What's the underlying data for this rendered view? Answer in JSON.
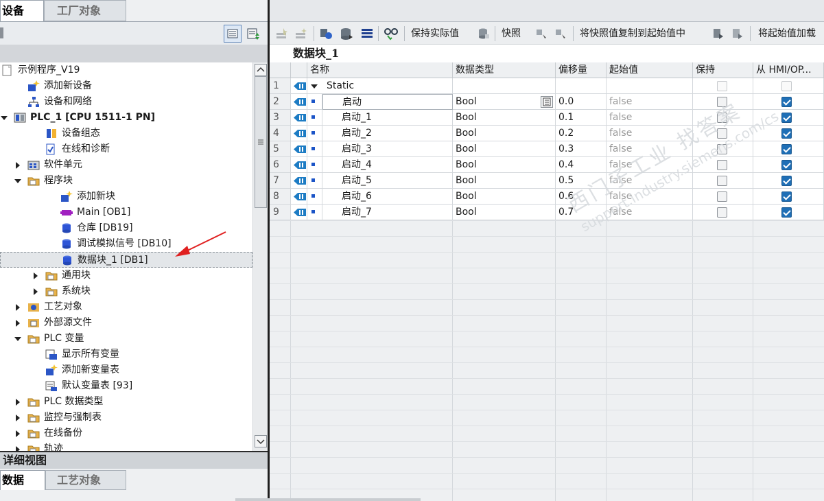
{
  "left_panel": {
    "tabs": [
      {
        "label": "设备"
      },
      {
        "label": "工厂对象"
      }
    ],
    "tree": [
      {
        "label": "示例程序_V19",
        "level": 0,
        "expander": "none",
        "icon": "project-icon"
      },
      {
        "label": "添加新设备",
        "level": 1,
        "expander": "none",
        "icon": "add-device-icon"
      },
      {
        "label": "设备和网络",
        "level": 1,
        "expander": "none",
        "icon": "network-icon"
      },
      {
        "label": "PLC_1 [CPU 1511-1 PN]",
        "level": 0,
        "expander": "down",
        "icon": "plc-icon",
        "bold": true
      },
      {
        "label": "设备组态",
        "level": 2,
        "expander": "none",
        "icon": "device-config-icon"
      },
      {
        "label": "在线和诊断",
        "level": 2,
        "expander": "none",
        "icon": "diagnostics-icon"
      },
      {
        "label": "软件单元",
        "level": 1,
        "expander": "right",
        "icon": "software-units-icon"
      },
      {
        "label": "程序块",
        "level": 1,
        "expander": "down",
        "icon": "folder-icon"
      },
      {
        "label": "添加新块",
        "level": 3,
        "expander": "none",
        "icon": "add-block-icon"
      },
      {
        "label": "Main [OB1]",
        "level": 3,
        "expander": "none",
        "icon": "ob-icon"
      },
      {
        "label": "仓库 [DB19]",
        "level": 3,
        "expander": "none",
        "icon": "db-icon"
      },
      {
        "label": "调试模拟信号 [DB10]",
        "level": 3,
        "expander": "none",
        "icon": "db-icon"
      },
      {
        "label": "数据块_1 [DB1]",
        "level": 3,
        "expander": "none",
        "icon": "db-icon",
        "selected": true
      },
      {
        "label": "通用块",
        "level": 2,
        "expander": "right",
        "icon": "folder-icon"
      },
      {
        "label": "系统块",
        "level": 2,
        "expander": "right",
        "icon": "folder-icon"
      },
      {
        "label": "工艺对象",
        "level": 1,
        "expander": "right",
        "icon": "technology-objects-icon"
      },
      {
        "label": "外部源文件",
        "level": 1,
        "expander": "right",
        "icon": "external-source-icon"
      },
      {
        "label": "PLC 变量",
        "level": 1,
        "expander": "down",
        "icon": "folder-icon"
      },
      {
        "label": "显示所有变量",
        "level": 2,
        "expander": "none",
        "icon": "show-tags-icon"
      },
      {
        "label": "添加新变量表",
        "level": 2,
        "expander": "none",
        "icon": "add-tag-table-icon"
      },
      {
        "label": "默认变量表 [93]",
        "level": 2,
        "expander": "none",
        "icon": "tag-table-icon"
      },
      {
        "label": "PLC 数据类型",
        "level": 1,
        "expander": "right",
        "icon": "folder-icon"
      },
      {
        "label": "监控与强制表",
        "level": 1,
        "expander": "right",
        "icon": "folder-icon"
      },
      {
        "label": "在线备份",
        "level": 1,
        "expander": "right",
        "icon": "folder-icon"
      },
      {
        "label": "轨迹",
        "level": 1,
        "expander": "right",
        "icon": "folder-icon"
      }
    ],
    "detail_view": {
      "title": "详细视图"
    },
    "bottom_tabs": [
      {
        "label": "数据"
      },
      {
        "label": "工艺对象"
      }
    ]
  },
  "toolbar": {
    "keep_actual_label": "保持实际值",
    "snapshot_label": "快照",
    "copy_snapshot_label": "将快照值复制到起始值中",
    "load_start_label": "将起始值加载"
  },
  "data_block": {
    "title": "数据块_1",
    "columns": [
      "名称",
      "数据类型",
      "偏移量",
      "起始值",
      "保持",
      "从 HMI/OP..."
    ],
    "static_row": {
      "num": "1",
      "name": "Static"
    },
    "rows": [
      {
        "num": "2",
        "name": "启动",
        "type": "Bool",
        "offset": "0.0",
        "start": "false",
        "retain": false,
        "hmi": true
      },
      {
        "num": "3",
        "name": "启动_1",
        "type": "Bool",
        "offset": "0.1",
        "start": "false",
        "retain": false,
        "hmi": true
      },
      {
        "num": "4",
        "name": "启动_2",
        "type": "Bool",
        "offset": "0.2",
        "start": "false",
        "retain": false,
        "hmi": true
      },
      {
        "num": "5",
        "name": "启动_3",
        "type": "Bool",
        "offset": "0.3",
        "start": "false",
        "retain": false,
        "hmi": true
      },
      {
        "num": "6",
        "name": "启动_4",
        "type": "Bool",
        "offset": "0.4",
        "start": "false",
        "retain": false,
        "hmi": true
      },
      {
        "num": "7",
        "name": "启动_5",
        "type": "Bool",
        "offset": "0.5",
        "start": "false",
        "retain": false,
        "hmi": true
      },
      {
        "num": "8",
        "name": "启动_6",
        "type": "Bool",
        "offset": "0.6",
        "start": "false",
        "retain": false,
        "hmi": true
      },
      {
        "num": "9",
        "name": "启动_7",
        "type": "Bool",
        "offset": "0.7",
        "start": "false",
        "retain": false,
        "hmi": true
      }
    ]
  },
  "watermark": {
    "line1": "西门子工业   找答案",
    "line2": "support.industry.siemens.com/cs"
  },
  "colors": {
    "accent": "#1f6fb6",
    "annotation_arrow": "#e02020",
    "db_icon": "#2e55d6"
  }
}
